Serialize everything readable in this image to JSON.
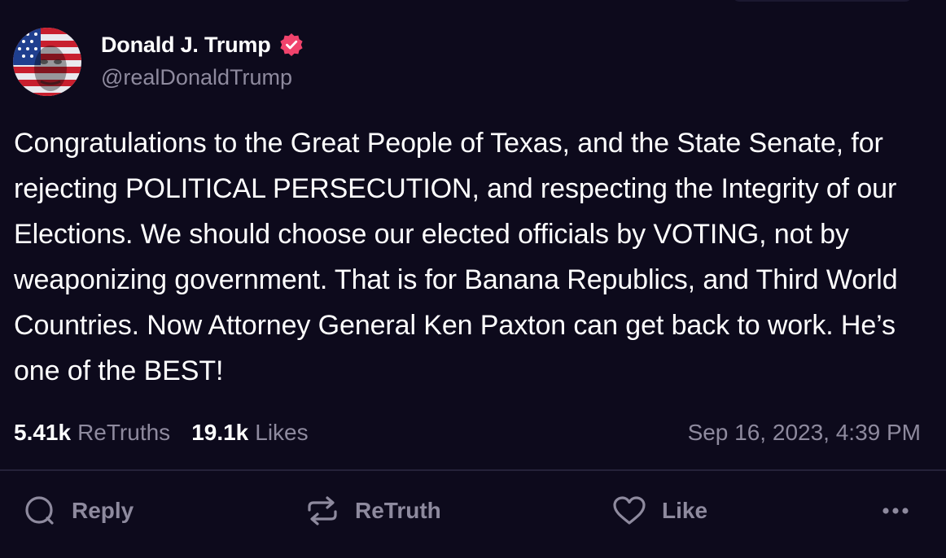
{
  "author": {
    "display_name": "Donald J. Trump",
    "handle": "@realDonaldTrump",
    "verified": true,
    "avatar_icon": "flag-portrait-avatar"
  },
  "post": {
    "text": "Congratulations to the Great People of Texas, and the State Senate, for rejecting POLITICAL PERSECUTION, and respecting the Integrity of our Elections. We should choose our elected officials by VOTING, not by weaponizing government. That is for Banana Republics, and Third World Countries. Now Attorney General Ken Paxton can get back to work. He’s one of the BEST!",
    "timestamp": "Sep 16, 2023, 4:39 PM"
  },
  "stats": {
    "retruths_count": "5.41k",
    "retruths_label": "ReTruths",
    "likes_count": "19.1k",
    "likes_label": "Likes"
  },
  "actions": {
    "reply_label": "Reply",
    "retruth_label": "ReTruth",
    "like_label": "Like",
    "reply_icon": "speech-bubble-icon",
    "retruth_icon": "repost-arrows-icon",
    "like_icon": "heart-icon",
    "more_icon": "more-dots-icon"
  },
  "colors": {
    "background": "#0d0a1c",
    "text_primary": "#ffffff",
    "text_secondary": "#8e8a9e",
    "verified_badge": "#f0436c",
    "divider": "#252239"
  }
}
